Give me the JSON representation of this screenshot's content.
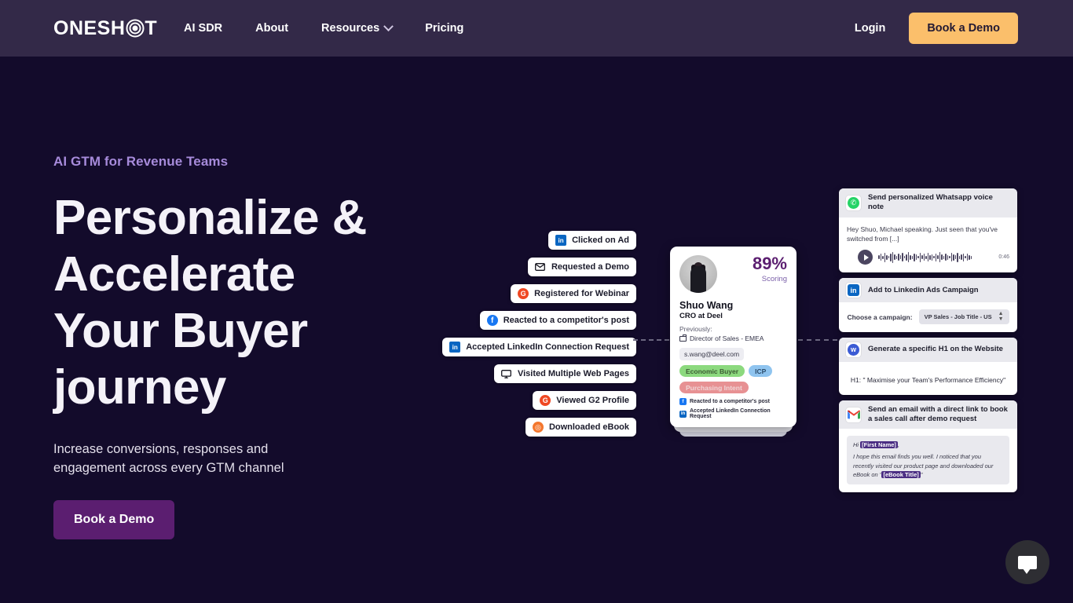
{
  "nav": {
    "logo_text_left": "ONESH",
    "logo_text_right": "T",
    "logo_icon": "target-rings-icon",
    "links": [
      {
        "label": "AI SDR",
        "has_chevron": false
      },
      {
        "label": "About",
        "has_chevron": false
      },
      {
        "label": "Resources",
        "has_chevron": true
      },
      {
        "label": "Pricing",
        "has_chevron": false
      }
    ],
    "login_label": "Login",
    "cta_label": "Book a Demo",
    "bg_color": "#332948",
    "cta_color": "#FBBF6B"
  },
  "hero": {
    "eyebrow": "AI GTM for Revenue Teams",
    "title": "Personalize & Accelerate Your Buyer journey",
    "subtitle": "Increase conversions, responses and engagement across every GTM channel",
    "cta_label": "Book a Demo",
    "cta_color": "#5B1E70",
    "bg_color": "#130B2B",
    "eyebrow_color": "#A78BDB"
  },
  "signals": [
    {
      "label": "Clicked on Ad",
      "icon": "linkedin-icon",
      "glyph": "in"
    },
    {
      "label": "Requested a Demo",
      "icon": "envelope-icon",
      "glyph": "✉"
    },
    {
      "label": "Registered for Webinar",
      "icon": "g2-icon",
      "glyph": "G"
    },
    {
      "label": "Reacted to a competitor's post",
      "icon": "facebook-icon",
      "glyph": "f"
    },
    {
      "label": "Accepted LinkedIn Connection Request",
      "icon": "linkedin-icon",
      "glyph": "in"
    },
    {
      "label": "Visited Multiple Web Pages",
      "icon": "monitor-icon",
      "glyph": "▭"
    },
    {
      "label": "Viewed G2 Profile",
      "icon": "g2-icon",
      "glyph": "G"
    },
    {
      "label": "Downloaded eBook",
      "icon": "ebook-icon",
      "glyph": "◎"
    }
  ],
  "profile": {
    "avatar": "person-photo-avatar",
    "score_value": "89%",
    "score_label": "Scoring",
    "name": "Shuo Wang",
    "role": "CRO at Deel",
    "previously_label": "Previously:",
    "previous_role": "Director of Sales - EMEA",
    "email": "s.wang@deel.com",
    "tags": [
      {
        "label": "Economic Buyer",
        "color": "#8CD97E"
      },
      {
        "label": "ICP",
        "color": "#8FC4EF"
      },
      {
        "label": "Purchasing Intent",
        "color": "#E79193"
      }
    ],
    "activities": [
      {
        "label": "Reacted to a competitor's post",
        "icon": "facebook-icon",
        "glyph": "f"
      },
      {
        "label": "Accepted LinkedIn Connection Request",
        "icon": "linkedin-icon",
        "glyph": "in"
      }
    ]
  },
  "actions": [
    {
      "id": "whatsapp",
      "icon": "whatsapp-icon",
      "title": "Send personalized Whatsapp voice note",
      "body_text": "Hey Shuo, Michael speaking. Just seen that you've switched from [...]",
      "audio_duration": "0:46",
      "play_icon": "play-icon"
    },
    {
      "id": "linkedin-ads",
      "icon": "linkedin-icon",
      "title": "Add to Linkedin Ads Campaign",
      "field_label": "Choose a campaign:",
      "field_value": "VP Sales - Job Title - US"
    },
    {
      "id": "website-h1",
      "icon": "webflow-icon",
      "title": "Generate a specific H1 on the Website",
      "body_text": "H1: \" Maximise your Team's Performance Efficiency\""
    },
    {
      "id": "email",
      "icon": "gmail-icon",
      "title": "Send an email with a direct link to book a sales call after demo request",
      "greeting_prefix": "Hi ",
      "greeting_token": "[First Name]",
      "greeting_suffix": ",",
      "body_part1": "I hope this email finds you well. I noticed that you recently visited our product page and downloaded our eBook on \"",
      "body_token": "[eBook Title]",
      "body_part2": "\""
    }
  ],
  "chat": {
    "icon": "chat-bubble-icon",
    "label": "Open chat"
  }
}
